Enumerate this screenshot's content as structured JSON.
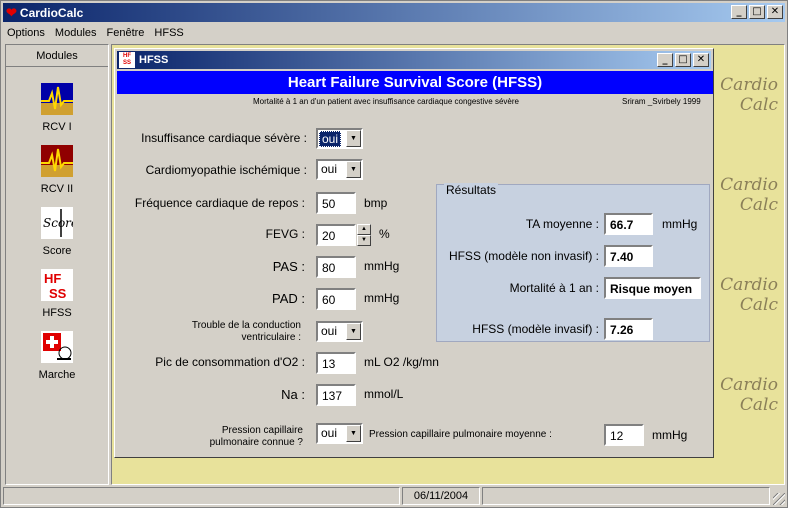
{
  "app": {
    "title": "CardioCalc",
    "icon": "heart-icon"
  },
  "menu": [
    "Options",
    "Modules",
    "Fenêtre",
    "HFSS"
  ],
  "sidebar": {
    "header": "Modules",
    "items": [
      {
        "label": "RCV I",
        "icon": "ecg-blue-icon"
      },
      {
        "label": "RCV II",
        "icon": "ecg-red-icon"
      },
      {
        "label": "Score",
        "icon": "score-icon"
      },
      {
        "label": "HFSS",
        "icon": "hfss-icon"
      },
      {
        "label": "Marche",
        "icon": "walk-icon"
      }
    ]
  },
  "background_deco": [
    "Cardio",
    "Calc"
  ],
  "child": {
    "title": "HFSS",
    "icon_text": "HF SS",
    "banner": "Heart Failure Survival Score (HFSS)",
    "subtitle": "Mortalité à 1 an d'un patient avec insuffisance cardiaque congestive sévère",
    "reference": "Sriram _Svirbely 1999"
  },
  "form": {
    "insuffisance": {
      "label": "Insuffisance cardiaque sévère :",
      "value": "oui"
    },
    "cardiomyopathie": {
      "label": "Cardiomyopathie ischémique :",
      "value": "oui"
    },
    "frequence": {
      "label": "Fréquence cardiaque de repos :",
      "value": "50",
      "unit": "bmp"
    },
    "fevg": {
      "label": "FEVG :",
      "value": "20",
      "unit": "%"
    },
    "pas": {
      "label": "PAS :",
      "value": "80",
      "unit": "mmHg"
    },
    "pad": {
      "label": "PAD :",
      "value": "60",
      "unit": "mmHg"
    },
    "trouble": {
      "label_line1": "Trouble de la conduction",
      "label_line2": "ventriculaire :",
      "value": "oui"
    },
    "pic": {
      "label": "Pic de consommation d'O2 :",
      "value": "13",
      "unit": "mL O2 /kg/mn"
    },
    "na": {
      "label": "Na :",
      "value": "137",
      "unit": "mmol/L"
    },
    "pression_connue": {
      "label_line1": "Pression capillaire",
      "label_line2": "pulmonaire connue ?",
      "value": "oui"
    },
    "pression_moyenne": {
      "label": "Pression capillaire pulmonaire  moyenne :",
      "value": "12",
      "unit": "mmHg"
    }
  },
  "results": {
    "title": "Résultats",
    "ta": {
      "label": "TA moyenne :",
      "value": "66.7",
      "unit": "mmHg"
    },
    "hfss_noninvasif": {
      "label": "HFSS (modèle non invasif) :",
      "value": "7.40"
    },
    "mortalite": {
      "label": "Mortalité à 1 an :",
      "value": "Risque moyen"
    },
    "hfss_invasif": {
      "label": "HFSS (modèle invasif) :",
      "value": "7.26"
    }
  },
  "statusbar": {
    "date": "06/11/2004"
  },
  "colors": {
    "titlebar": "#0a246a",
    "banner": "#0000ff",
    "mdi_bg": "#e8e29b",
    "results_bg": "#c7d1e0"
  }
}
